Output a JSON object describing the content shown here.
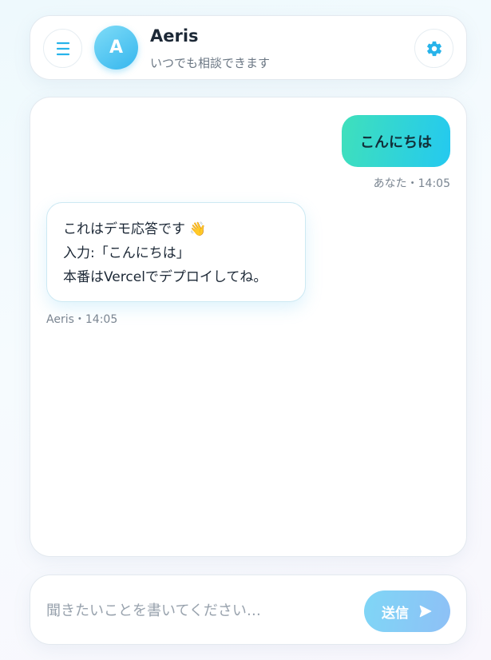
{
  "header": {
    "menu_icon": "menu-icon",
    "avatar_letter": "A",
    "title": "Aeris",
    "subtitle": "いつでも相談できます",
    "settings_icon": "gear-icon"
  },
  "messages": [
    {
      "role": "user",
      "text": "こんにちは",
      "meta": "あなた・14:05"
    },
    {
      "role": "assistant",
      "lines": [
        "これはデモ応答です 👋",
        "入力:「こんにちは」",
        "本番はVercelでデプロイしてね。"
      ],
      "meta": "Aeris・14:05"
    }
  ],
  "composer": {
    "placeholder": "聞きたいことを書いてください…",
    "value": "",
    "send_label": "送信",
    "send_icon": "send-arrow-icon"
  },
  "colors": {
    "accent": "#35b6ee",
    "user_bubble_start": "#3fe0bb",
    "user_bubble_end": "#24c9f0",
    "send_button": "#8ec8f6"
  }
}
